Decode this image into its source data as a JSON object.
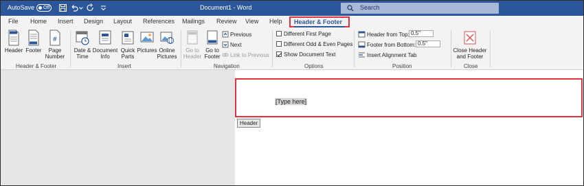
{
  "titlebar": {
    "autosave_label": "AutoSave",
    "autosave_state": "Off",
    "document_title": "Document1 - Word",
    "search_placeholder": "Search"
  },
  "tabs": [
    "File",
    "Home",
    "Insert",
    "Design",
    "Layout",
    "References",
    "Mailings",
    "Review",
    "View",
    "Help"
  ],
  "active_tab": "Header & Footer",
  "groups": {
    "header_footer": {
      "label": "Header & Footer",
      "header": "Header",
      "footer": "Footer",
      "page_number_1": "Page",
      "page_number_2": "Number"
    },
    "insert": {
      "label": "Insert",
      "date_time_1": "Date &",
      "date_time_2": "Time",
      "doc_info_1": "Document",
      "doc_info_2": "Info",
      "quick_parts_1": "Quick",
      "quick_parts_2": "Parts",
      "pictures": "Pictures",
      "online_pictures_1": "Online",
      "online_pictures_2": "Pictures"
    },
    "navigation": {
      "label": "Navigation",
      "go_to_header_1": "Go to",
      "go_to_header_2": "Header",
      "go_to_footer_1": "Go to",
      "go_to_footer_2": "Footer",
      "previous": "Previous",
      "next": "Next",
      "link_to_previous": "Link to Previous"
    },
    "options": {
      "label": "Options",
      "different_first_page": "Different First Page",
      "different_odd_even": "Different Odd & Even Pages",
      "show_document_text": "Show Document Text",
      "show_document_text_checked": true
    },
    "position": {
      "label": "Position",
      "header_from_top": "Header from Top:",
      "header_from_top_value": "0.5\"",
      "footer_from_bottom": "Footer from Bottom:",
      "footer_from_bottom_value": "0.5\"",
      "insert_alignment_tab": "Insert Alignment Tab"
    },
    "close": {
      "label": "Close",
      "close_1": "Close Header",
      "close_2": "and Footer"
    }
  },
  "document": {
    "placeholder": "[Type here]",
    "header_tag": "Header"
  },
  "colors": {
    "title_bar": "#2b579a",
    "highlight": "#e0333f"
  }
}
